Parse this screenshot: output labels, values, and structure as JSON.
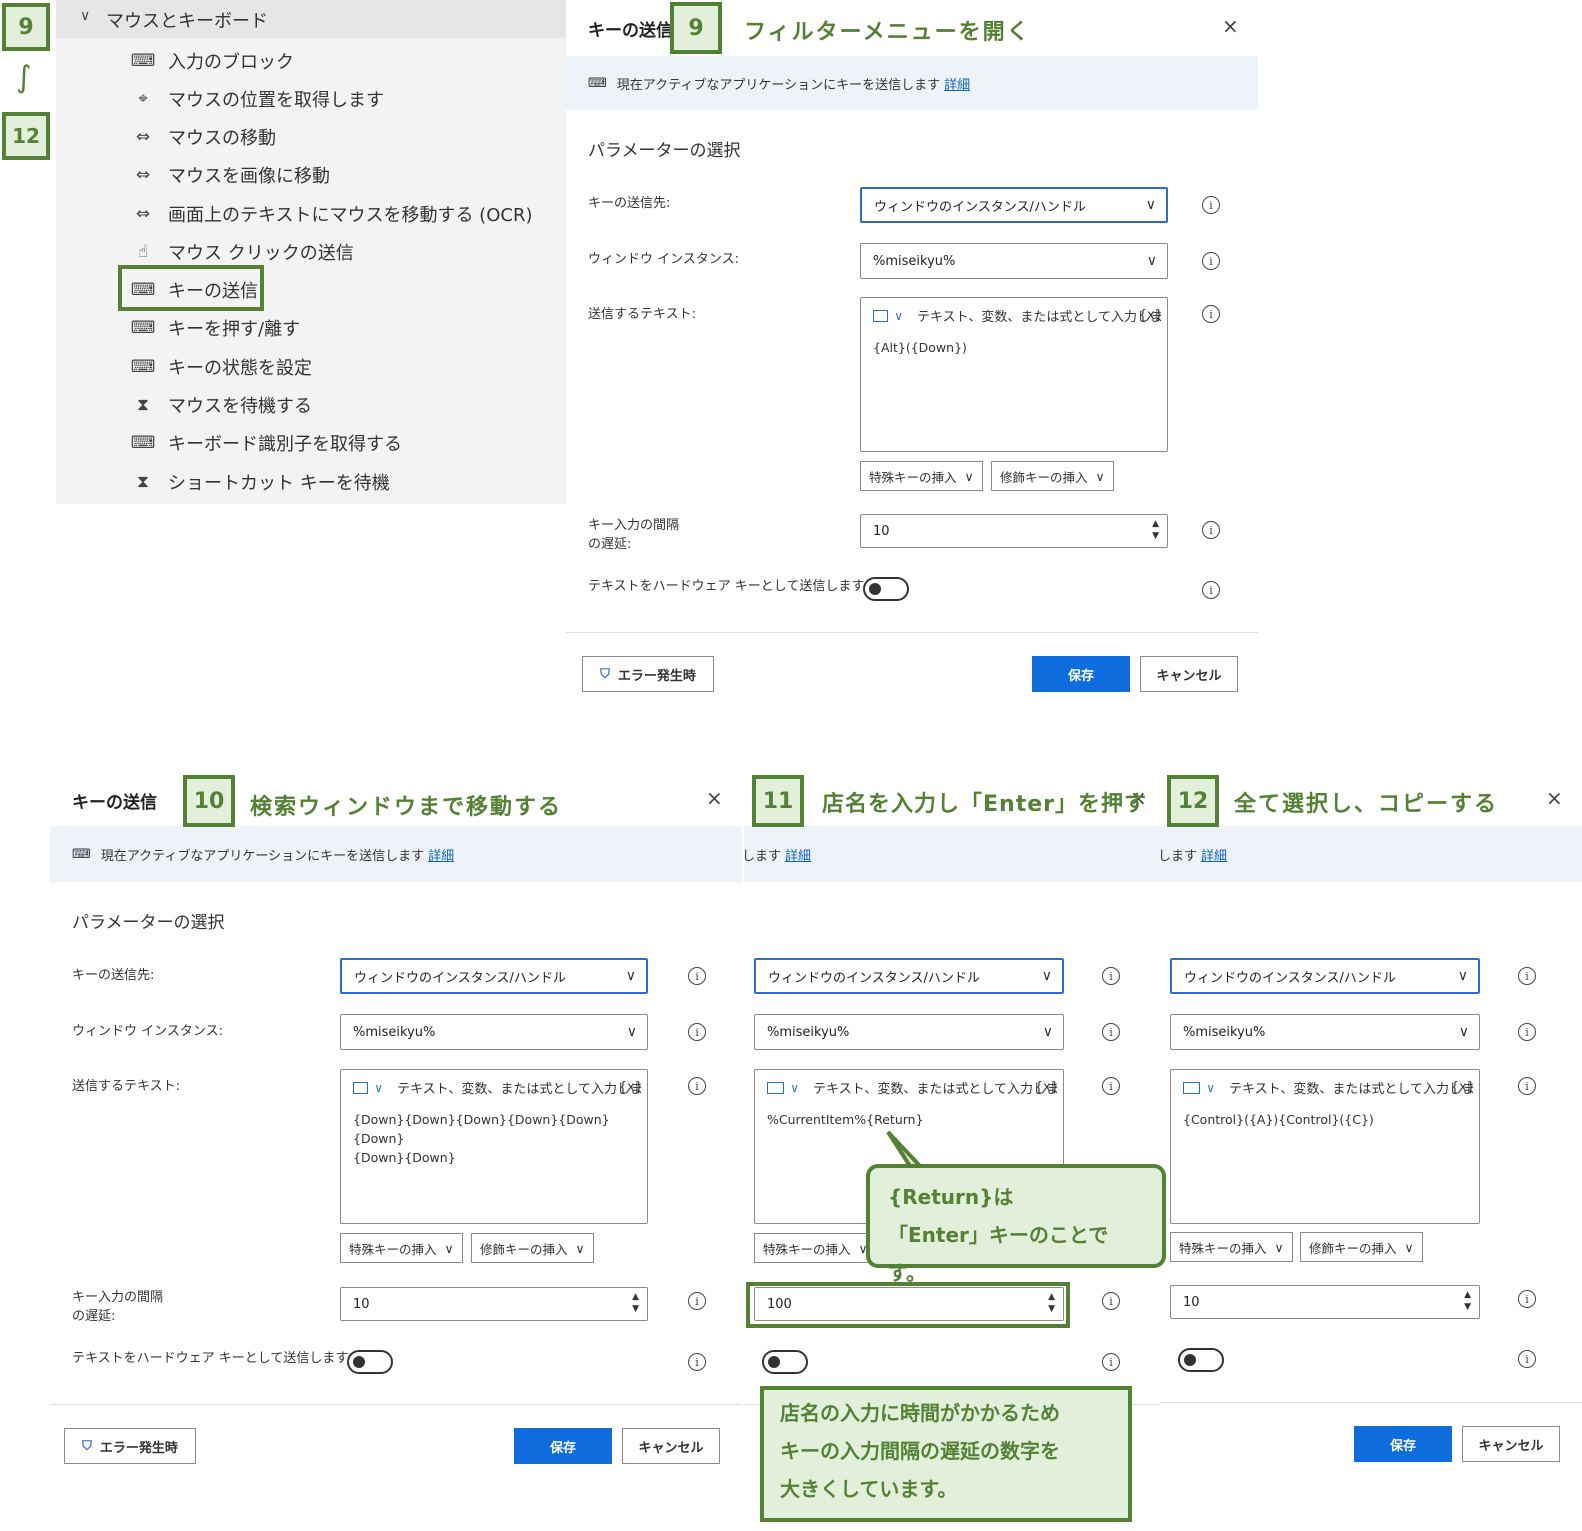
{
  "steps": {
    "step9_badge_left": "9",
    "range_mark": "∫",
    "step12_badge_left": "12",
    "step9_badge": "9",
    "step9_title": "フィルターメニューを開く",
    "step10_badge": "10",
    "step10_title": "検索ウィンドウまで移動する",
    "step11_badge": "11",
    "step11_title": "店名を入力し「Enter」を押す",
    "step12_badge": "12",
    "step12_title": "全て選択し、コピーする"
  },
  "action_panel": {
    "group_label": "マウスとキーボード",
    "items": [
      {
        "icon": "keyboard-icon",
        "glyph": "⌨",
        "label": "入力のブロック"
      },
      {
        "icon": "crosshair-icon",
        "glyph": "⌖",
        "label": "マウスの位置を取得します"
      },
      {
        "icon": "mouse-move-icon",
        "glyph": "⇔",
        "label": "マウスの移動"
      },
      {
        "icon": "mouse-move-icon",
        "glyph": "⇔",
        "label": "マウスを画像に移動"
      },
      {
        "icon": "mouse-move-icon",
        "glyph": "⇔",
        "label": "画面上のテキストにマウスを移動する (OCR)"
      },
      {
        "icon": "mouse-click-icon",
        "glyph": "☝",
        "label": "マウス クリックの送信"
      },
      {
        "icon": "keyboard-icon",
        "glyph": "⌨",
        "label": "キーの送信"
      },
      {
        "icon": "keyboard-icon",
        "glyph": "⌨",
        "label": "キーを押す/離す"
      },
      {
        "icon": "keyboard-icon",
        "glyph": "⌨",
        "label": "キーの状態を設定"
      },
      {
        "icon": "hourglass-icon",
        "glyph": "⧗",
        "label": "マウスを待機する"
      },
      {
        "icon": "keyboard-icon",
        "glyph": "⌨",
        "label": "キーボード識別子を取得する"
      },
      {
        "icon": "hourglass-icon",
        "glyph": "⧗",
        "label": "ショートカット キーを待機"
      }
    ]
  },
  "dialog": {
    "title": "キーの送信",
    "banner_text": "現在アクティブなアプリケーションにキーを送信します",
    "banner_text_cut": "送信します",
    "banner_link": "詳細",
    "section": "パラメーターの選択",
    "label_target": "キーの送信先:",
    "label_instance": "ウィンドウ インスタンス:",
    "label_text": "送信するテキスト:",
    "label_delay_1": "キー入力の間隔",
    "label_delay_2": "の遅延:",
    "label_hardware": "テキストをハードウェア キーとして送信します:",
    "target_value": "ウィンドウのインスタンス/ハンドル",
    "instance_value": "%miseikyu%",
    "text_placeholder": "テキスト、変数、または式として入力しま",
    "var_button": "{x}",
    "special_key": "特殊キーの挿入",
    "modifier_key": "修飾キーの挿入",
    "error_button": "エラー発生時",
    "save_button": "保存",
    "cancel_button": "キャンセル",
    "close": "×",
    "info": "i"
  },
  "dialogs": {
    "d9": {
      "text_value": "{Alt}({Down})",
      "delay": "10"
    },
    "d10": {
      "text_value_1": "{Down}{Down}{Down}{Down}{Down}{Down}",
      "text_value_2": "{Down}{Down}",
      "delay": "10"
    },
    "d11": {
      "text_value": "%CurrentItem%{Return}",
      "delay": "100"
    },
    "d12": {
      "text_value": "{Control}({A}){Control}({C})",
      "delay": "10"
    }
  },
  "callouts": {
    "return_note": "{Return}は\n「Enter」キーのことです。",
    "delay_note": "店名の入力に時間がかかるため\nキーの入力間隔の遅延の数字を\n大きくしています。"
  },
  "colors": {
    "accent_green": "#548235",
    "callout_bg": "#e2efda",
    "primary_blue": "#0f6cdc"
  }
}
